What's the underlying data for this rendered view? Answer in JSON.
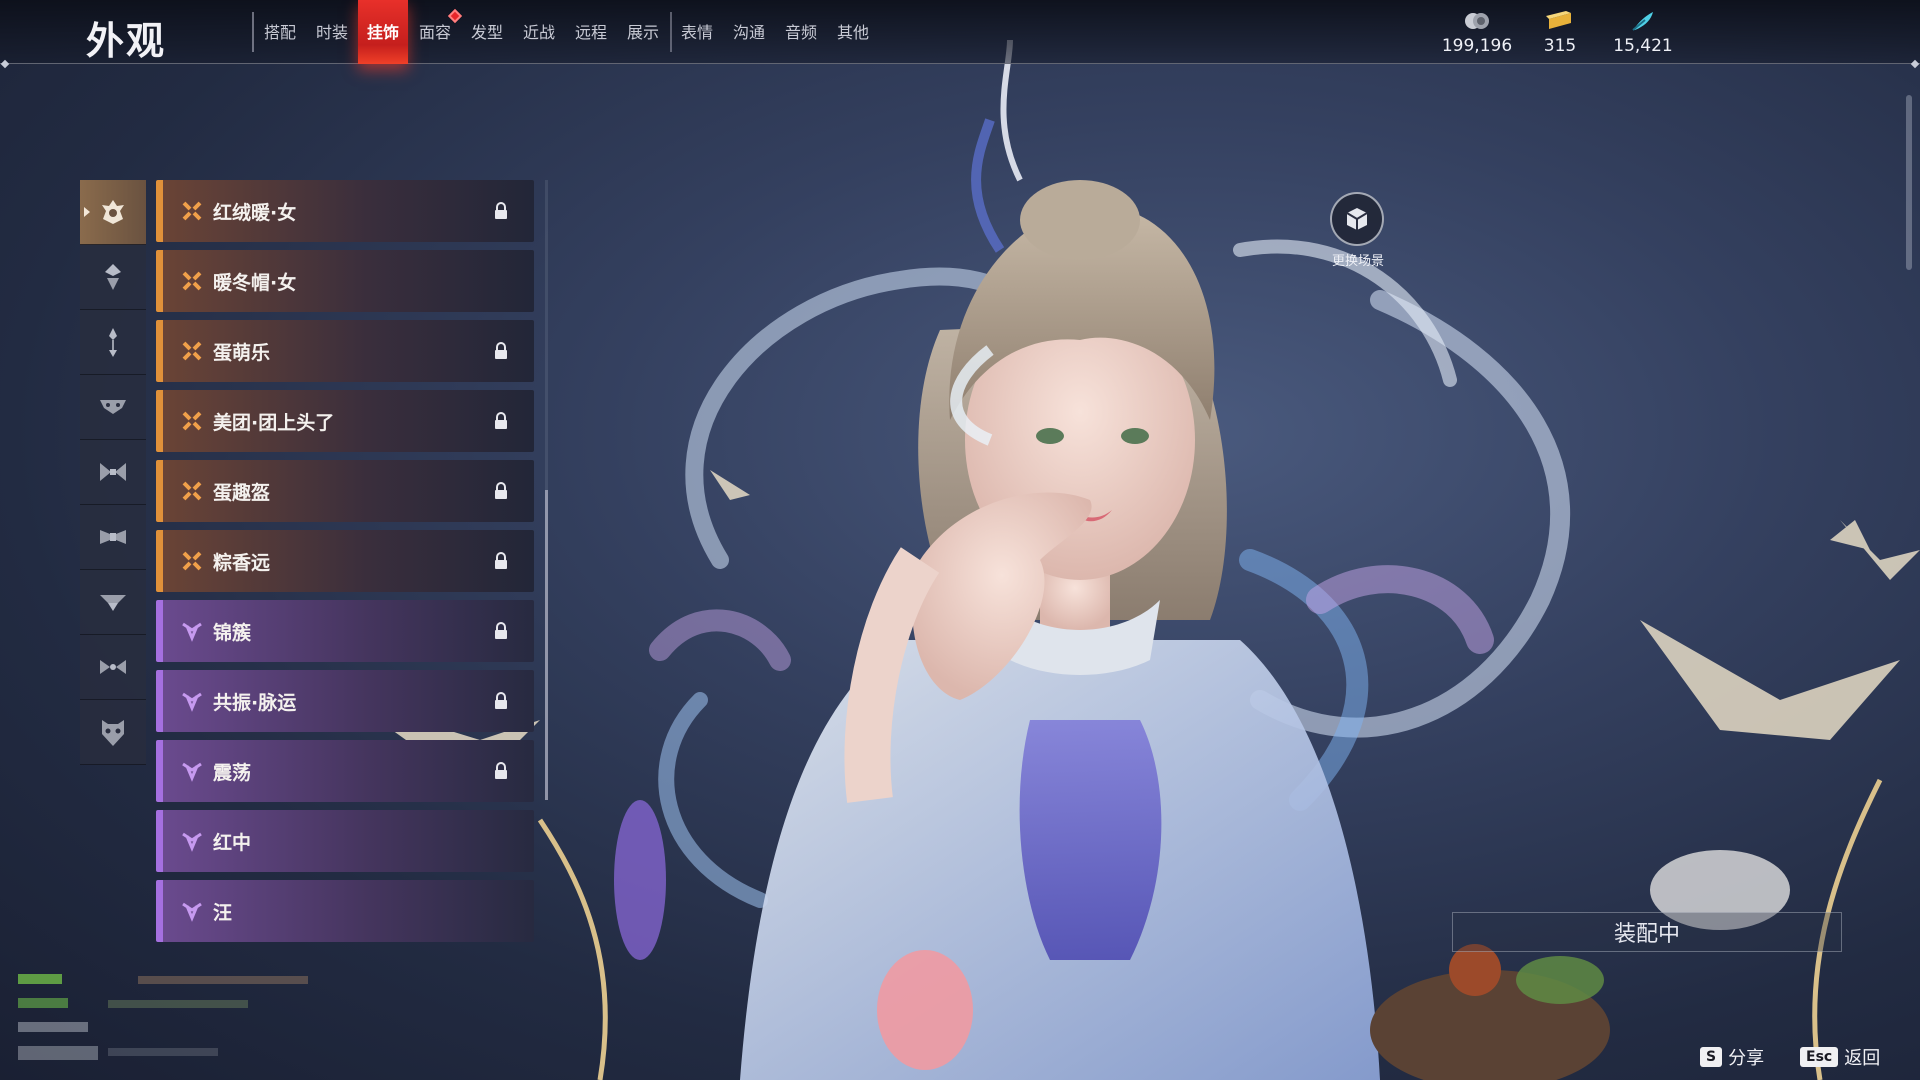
{
  "header": {
    "title": "外观",
    "tabs": [
      {
        "label": "搭配",
        "active": false
      },
      {
        "label": "时装",
        "active": false
      },
      {
        "label": "挂饰",
        "active": true
      },
      {
        "label": "面容",
        "active": false,
        "badge": true
      },
      {
        "label": "发型",
        "active": false
      },
      {
        "label": "近战",
        "active": false
      },
      {
        "label": "远程",
        "active": false
      },
      {
        "label": "展示",
        "active": false
      },
      {
        "label": "表情",
        "active": false
      },
      {
        "label": "沟通",
        "active": false
      },
      {
        "label": "音频",
        "active": false
      },
      {
        "label": "其他",
        "active": false
      }
    ],
    "currencies": [
      {
        "icon": "coin-icon",
        "value": "199,196"
      },
      {
        "icon": "gold-ingot-icon",
        "value": "315"
      },
      {
        "icon": "feather-icon",
        "value": "15,421"
      }
    ]
  },
  "categories": [
    {
      "icon": "head-ornament-icon",
      "active": true
    },
    {
      "icon": "hairpin-icon",
      "active": false
    },
    {
      "icon": "earring-icon",
      "active": false
    },
    {
      "icon": "face-ornament-icon",
      "active": false
    },
    {
      "icon": "back-ornament-icon",
      "active": false
    },
    {
      "icon": "waist-ornament-icon",
      "active": false
    },
    {
      "icon": "arm-ornament-icon",
      "active": false
    },
    {
      "icon": "tail-ornament-icon",
      "active": false
    },
    {
      "icon": "mask-icon",
      "active": false
    }
  ],
  "items": [
    {
      "name": "红绒暖·女",
      "rarity": "orange",
      "locked": true
    },
    {
      "name": "暖冬帽·女",
      "rarity": "orange",
      "locked": false
    },
    {
      "name": "蛋萌乐",
      "rarity": "orange",
      "locked": true
    },
    {
      "name": "美团·团上头了",
      "rarity": "orange",
      "locked": true
    },
    {
      "name": "蛋趣盔",
      "rarity": "orange",
      "locked": true
    },
    {
      "name": "粽香远",
      "rarity": "orange",
      "locked": true
    },
    {
      "name": "锦簇",
      "rarity": "purple",
      "locked": true
    },
    {
      "name": "共振·脉运",
      "rarity": "purple",
      "locked": true
    },
    {
      "name": "震荡",
      "rarity": "purple",
      "locked": true
    },
    {
      "name": "红中",
      "rarity": "purple",
      "locked": false
    },
    {
      "name": "汪",
      "rarity": "purple",
      "locked": false
    }
  ],
  "scene_button": {
    "label": "更换场景",
    "icon": "cube-icon"
  },
  "equip_status": "装配中",
  "hints": [
    {
      "key": "S",
      "label": "分享"
    },
    {
      "key": "Esc",
      "label": "返回"
    }
  ],
  "colors": {
    "accent_red": "#e8302a",
    "rarity_orange": "#e0913a",
    "rarity_purple": "#a570e0"
  }
}
